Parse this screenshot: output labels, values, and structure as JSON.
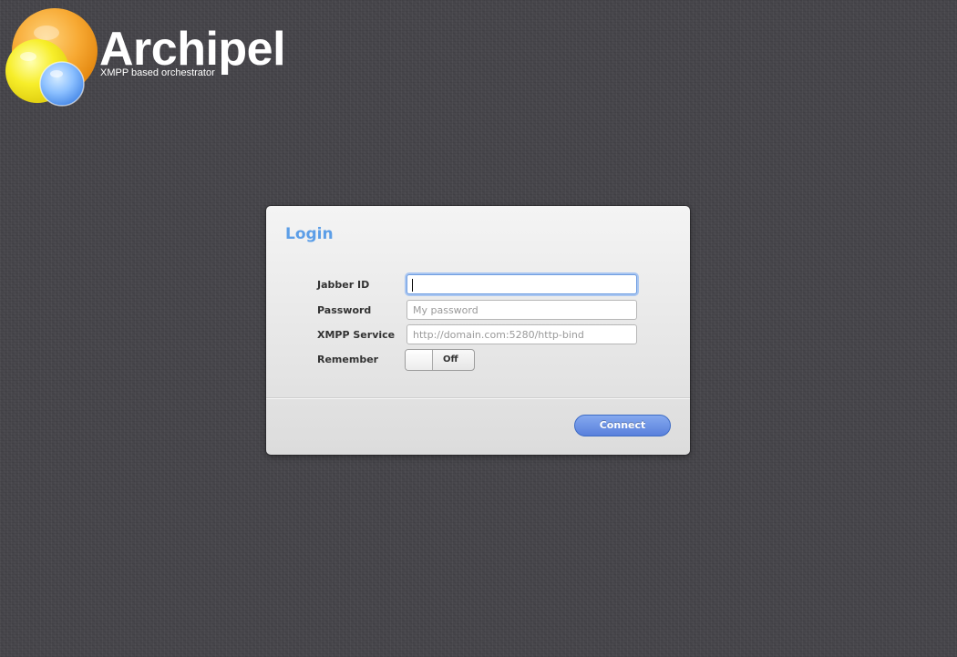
{
  "logo": {
    "title": "Archipel",
    "tagline": "XMPP based orchestrator",
    "icon": "archipel-spheres-logo"
  },
  "login": {
    "title": "Login",
    "fields": {
      "jabber_id": {
        "label": "Jabber ID",
        "value": "",
        "placeholder": ""
      },
      "password": {
        "label": "Password",
        "value": "",
        "placeholder": "My password"
      },
      "xmpp_service": {
        "label": "XMPP Service",
        "value": "",
        "placeholder": "http://domain.com:5280/http-bind"
      }
    },
    "remember": {
      "label": "Remember",
      "state": "Off"
    },
    "connect_label": "Connect"
  },
  "colors": {
    "background": "#48474c",
    "title_accent": "#5c9ee7",
    "button": "#5980dc",
    "logo_orange": "#f5a623",
    "logo_yellow": "#f3e62a",
    "logo_blue": "#7fb4ff"
  }
}
